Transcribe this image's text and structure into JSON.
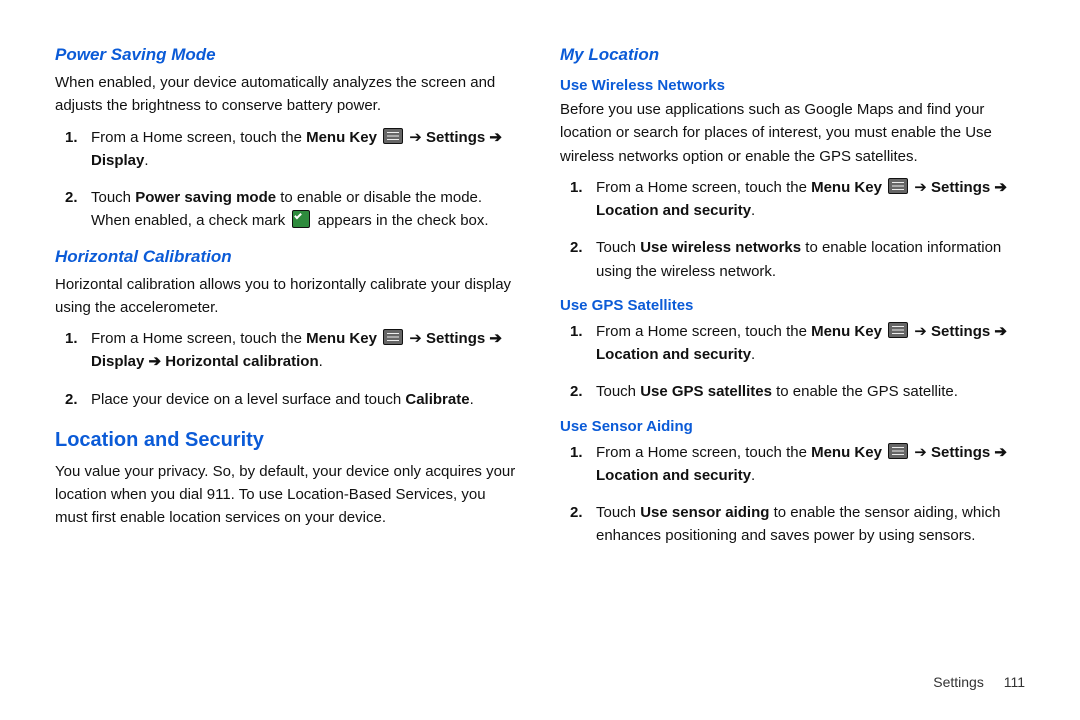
{
  "arrow": "➔",
  "left": {
    "powerSaving": {
      "heading": "Power Saving Mode",
      "body": "When enabled, your device automatically analyzes the screen and adjusts the brightness to conserve battery power.",
      "s1a": "From a Home screen, touch the ",
      "s1b": "Menu Key",
      "s1c": "Settings ",
      "s1d": "Display",
      "s2a": "Touch ",
      "s2b": "Power saving mode",
      "s2c": " to enable or disable the mode. When enabled, a check mark ",
      "s2d": " appears in the check box."
    },
    "horizCal": {
      "heading": "Horizontal Calibration",
      "body": "Horizontal calibration allows you to horizontally calibrate your display using the accelerometer.",
      "s1a": "From a Home screen, touch the ",
      "s1b": "Menu Key",
      "s1c": "Settings ",
      "s1d": "Display ",
      "s1e": "Horizontal calibration",
      "s2a": "Place your device on a level surface and touch ",
      "s2b": "Calibrate"
    },
    "locSec": {
      "heading": "Location and Security",
      "body": "You value your privacy. So, by default, your device only acquires your location when you dial 911. To use Location-Based Services, you must first enable location services on your device."
    }
  },
  "right": {
    "myLoc": {
      "heading": "My Location"
    },
    "wireless": {
      "heading": "Use Wireless Networks",
      "body": "Before you use applications such as Google Maps and find your location or search for places of interest, you must enable the Use wireless networks option or enable the GPS satellites.",
      "s1a": "From a Home screen, touch the ",
      "s1b": "Menu Key",
      "s1c": "Settings ",
      "s1d": "Location and security",
      "s2a": "Touch ",
      "s2b": "Use wireless networks",
      "s2c": " to enable location information using the wireless network."
    },
    "gps": {
      "heading": "Use GPS Satellites",
      "s1a": "From a Home screen, touch the ",
      "s1b": "Menu Key",
      "s1c": "Settings ",
      "s1d": "Location and security",
      "s2a": "Touch ",
      "s2b": "Use GPS satellites",
      "s2c": " to enable the GPS satellite."
    },
    "sensor": {
      "heading": "Use Sensor Aiding",
      "s1a": "From a Home screen, touch the ",
      "s1b": "Menu Key",
      "s1c": "Settings ",
      "s1d": "Location and security",
      "s2a": "Touch ",
      "s2b": "Use sensor aiding",
      "s2c": " to enable the sensor aiding, which enhances positioning and saves power by using sensors."
    }
  },
  "footer": {
    "section": "Settings",
    "page": "111"
  }
}
